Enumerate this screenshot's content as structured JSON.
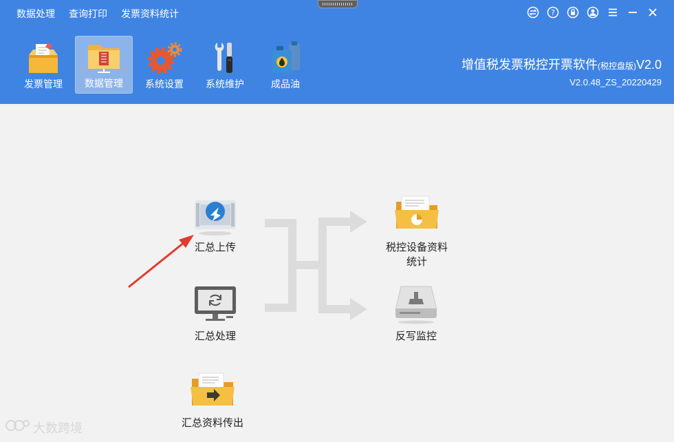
{
  "menu": [
    "数据处理",
    "查询打印",
    "发票资料统计"
  ],
  "window_controls": [
    "switch-icon",
    "help-icon",
    "lock-icon",
    "user-icon",
    "menu-icon",
    "minimize-icon",
    "close-icon"
  ],
  "toolbar": {
    "items": [
      {
        "label": "发票管理",
        "icon": "invoice-box-icon"
      },
      {
        "label": "数据管理",
        "icon": "data-folder-icon",
        "active": true
      },
      {
        "label": "系统设置",
        "icon": "gears-icon"
      },
      {
        "label": "系统维护",
        "icon": "tools-icon"
      },
      {
        "label": "成品油",
        "icon": "oil-can-icon"
      }
    ]
  },
  "brand": {
    "title": "增值税发票税控开票软件",
    "edition": "(税控盘版)",
    "suffix": "V2.0",
    "version": "V2.0.48_ZS_20220429"
  },
  "functions": {
    "upload": "汇总上传",
    "process": "汇总处理",
    "export": "汇总资料传出",
    "stats": "税控设备资料统计",
    "monitor": "反写监控"
  },
  "watermark": "大数跨境",
  "colors": {
    "header": "#3f84e3",
    "active_tab": "#8db4e9",
    "background": "#f2f2f2",
    "arrow": "#e23a2e",
    "flow": "#d8d8d8"
  }
}
